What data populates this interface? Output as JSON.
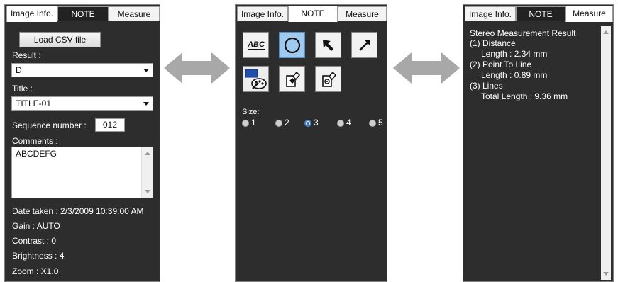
{
  "panel1": {
    "tabs": [
      "Image Info.",
      "NOTE",
      "Measure"
    ],
    "load_button": "Load CSV file",
    "result_label": "Result :",
    "result_value": "D",
    "title_label": "Title :",
    "title_value": "TITLE-01",
    "sequence_label": "Sequence number :",
    "sequence_value": "012",
    "comments_label": "Comments :",
    "comments_value": "ABCDEFG",
    "info": [
      "Date taken : 2/3/2009 10:39:00 AM",
      "Gain : AUTO",
      "Contrast : 0",
      "Brightness : 4",
      "Zoom : X1.0"
    ]
  },
  "panel2": {
    "tabs": [
      "Image Info.",
      "NOTE",
      "Measure"
    ],
    "tools": [
      "text-tool-icon",
      "ellipse-tool-icon",
      "arrow-tool-icon",
      "arrow-line-tool-icon",
      "color-palette-icon",
      "eraser-icon",
      "eraser-all-icon"
    ],
    "abc_glyph": "ABC",
    "size_label": "Size:",
    "sizes": [
      "1",
      "2",
      "3",
      "4",
      "5"
    ],
    "selected_size": "3",
    "accent": "#9fc9ef",
    "fill_color": "#1f4fa8"
  },
  "panel3": {
    "tabs": [
      "Image Info.",
      "NOTE",
      "Measure"
    ],
    "result_lines": [
      "Stereo Measurement Result",
      "(1) Distance",
      "Length : 2.34 mm",
      "(2) Point To Line",
      "Length : 0.89 mm",
      "(3) Lines",
      "Total Length : 9.36 mm"
    ]
  },
  "colors": {
    "panel_bg": "#2d2d2d",
    "arrow": "#a8a8a8"
  }
}
